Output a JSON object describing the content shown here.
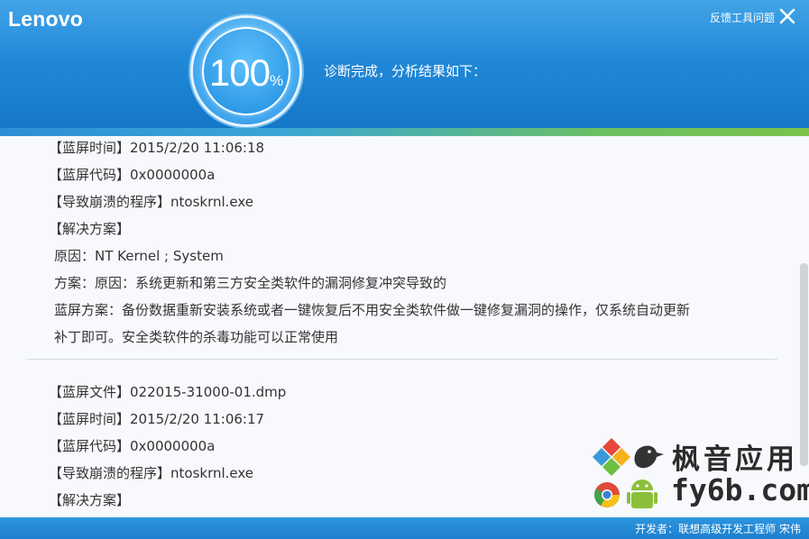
{
  "app": {
    "logo_text": "Lenovo",
    "feedback_label": "反馈工具问题"
  },
  "progress": {
    "value": "100",
    "unit": "%",
    "status": "诊断完成，分析结果如下："
  },
  "report": {
    "entry1": {
      "time": "【蓝屏时间】2015/2/20 11:06:18",
      "code": "【蓝屏代码】0x0000000a",
      "program": "【导致崩溃的程序】ntoskrnl.exe",
      "solution_heading": "【解决方案】",
      "cause": "原因：NT Kernel ; System",
      "plan": "方案：原因：系统更新和第三方安全类软件的漏洞修复冲突导致的",
      "bsod_plan_line1": "蓝屏方案：备份数据重新安装系统或者一键恢复后不用安全类软件做一键修复漏洞的操作，仅系统自动更新",
      "bsod_plan_line2": "补丁即可。安全类软件的杀毒功能可以正常使用"
    },
    "entry2": {
      "file": "【蓝屏文件】022015-31000-01.dmp",
      "time": "【蓝屏时间】2015/2/20 11:06:17",
      "code": "【蓝屏代码】0x0000000a",
      "program": "【导致崩溃的程序】ntoskrnl.exe",
      "solution_heading": "【解决方案】"
    }
  },
  "watermark": {
    "line1": "枫音应用",
    "line2": "fy6b.com"
  },
  "footer": {
    "developer": "开发者：联想高级开发工程师 宋伟"
  },
  "colors": {
    "header_blue": "#1f86d6",
    "accent_green": "#7cc34b",
    "text": "#333333"
  }
}
